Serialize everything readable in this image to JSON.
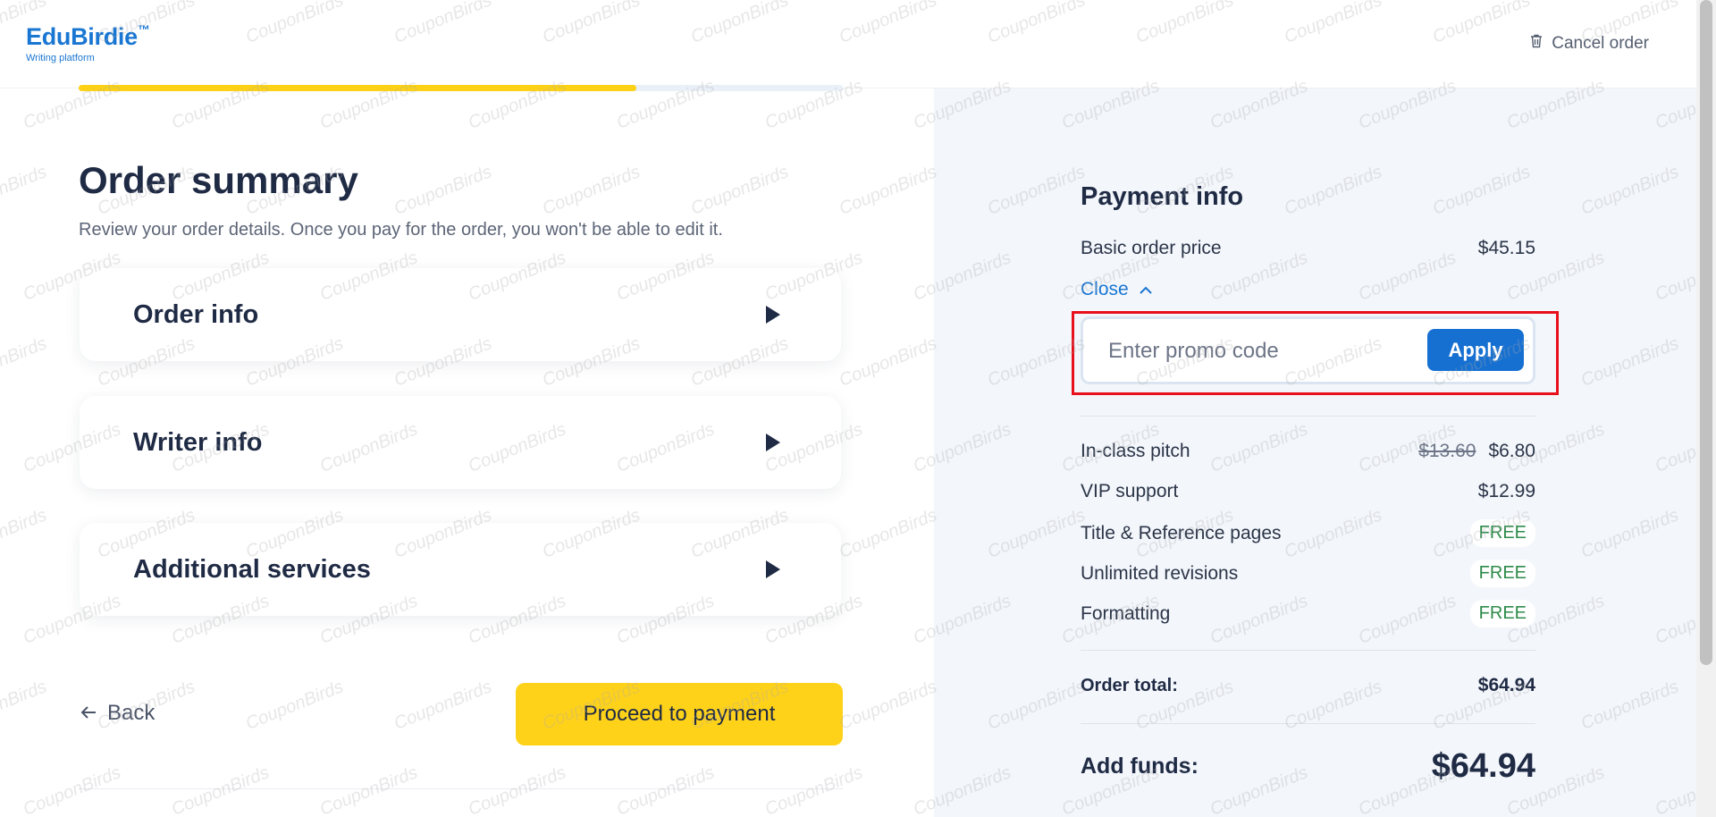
{
  "header": {
    "brand": "EduBirdie",
    "brand_mark": "™",
    "tagline": "Writing platform",
    "cancel_label": "Cancel order",
    "cancel_icon": "trash-icon"
  },
  "progress": {
    "fraction": 0.73,
    "color": "#fcd116"
  },
  "main": {
    "title": "Order summary",
    "subtitle": "Review your order details. Once you pay for the order, you won't be able to edit it.",
    "sections": [
      {
        "label": "Order info"
      },
      {
        "label": "Writer info"
      },
      {
        "label": "Additional services"
      }
    ],
    "back_label": "Back",
    "proceed_label": "Proceed to payment"
  },
  "payment": {
    "title": "Payment info",
    "basic_label": "Basic order price",
    "basic_value": "$45.15",
    "toggle_label": "Close",
    "promo_placeholder": "Enter promo code",
    "apply_label": "Apply",
    "extras": [
      {
        "label": "In-class pitch",
        "old": "$13.60",
        "value": "$6.80"
      },
      {
        "label": "VIP support",
        "value": "$12.99"
      },
      {
        "label": "Title & Reference pages",
        "value": "FREE"
      },
      {
        "label": "Unlimited revisions",
        "value": "FREE"
      },
      {
        "label": "Formatting",
        "value": "FREE"
      }
    ],
    "total_label": "Order total:",
    "total_value": "$64.94",
    "funds_label": "Add funds:",
    "funds_value": "$64.94"
  },
  "watermark_text": "CouponBirds",
  "colors": {
    "accent": "#1976d2",
    "cta": "#ffd21a",
    "highlight": "#e8101a",
    "free": "#2e8b4a"
  }
}
